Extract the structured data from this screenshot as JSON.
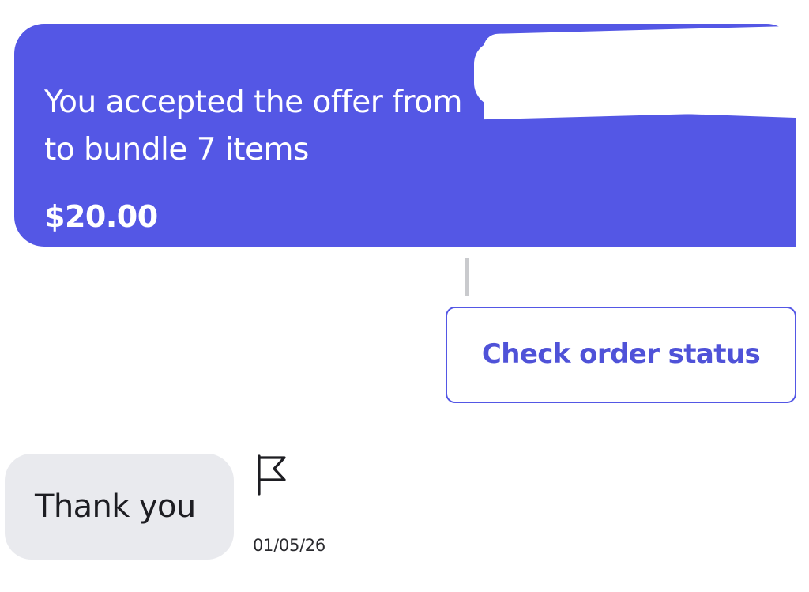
{
  "offer": {
    "line1": "You accepted the offer from",
    "line2": "to bundle 7 items",
    "price": "$20.00"
  },
  "actions": {
    "check_order_status": "Check order status"
  },
  "message": {
    "text": "Thank you",
    "date": "01/05/26"
  },
  "icons": {
    "report": "flag-icon"
  },
  "colors": {
    "accent": "#5457e5",
    "reply_bubble": "#e9eaee",
    "text_dark": "#1d1d22"
  }
}
